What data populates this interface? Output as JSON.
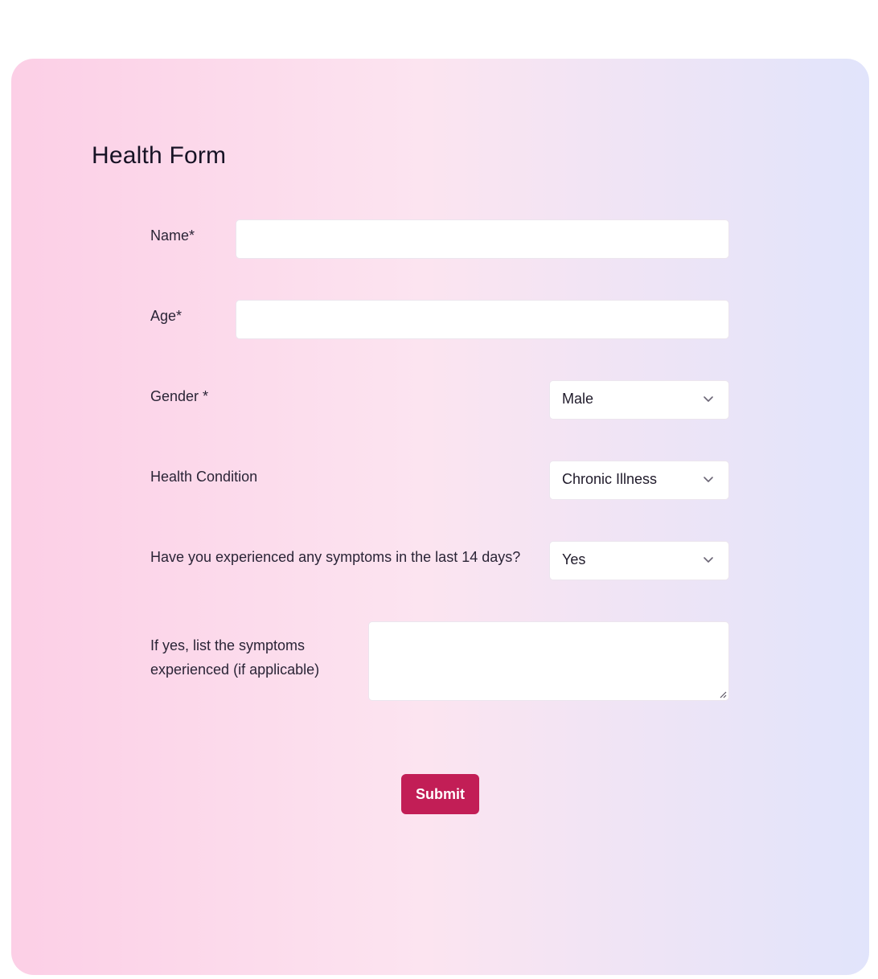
{
  "form": {
    "title": "Health Form",
    "fields": {
      "name": {
        "label": "Name*",
        "value": ""
      },
      "age": {
        "label": "Age*",
        "value": ""
      },
      "gender": {
        "label": "Gender *",
        "selected": "Male"
      },
      "health_condition": {
        "label": "Health Condition",
        "selected": "Chronic Illness"
      },
      "symptoms_question": {
        "label": "Have you experienced any symptoms in the last 14 days?",
        "selected": "Yes"
      },
      "symptoms_list": {
        "label_line1": "If yes, list the symptoms",
        "label_line2": "experienced (if applicable)",
        "value": ""
      }
    },
    "submit_label": "Submit"
  },
  "icons": {
    "select_arrow": "chevron-down-icon",
    "textarea_handle": "resize-handle-icon"
  },
  "colors": {
    "accent": "#c21e56",
    "gradient_left": "#fccfe6",
    "gradient_right": "#e1e4fb"
  }
}
